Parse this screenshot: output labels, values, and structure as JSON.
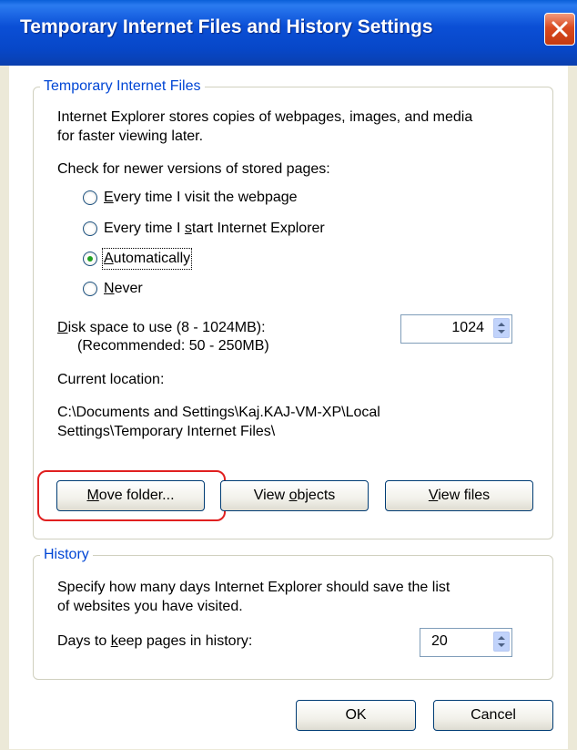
{
  "window": {
    "title": "Temporary Internet Files and History Settings"
  },
  "tif": {
    "legend": "Temporary Internet Files",
    "description_line1": "Internet Explorer stores copies of webpages, images, and media",
    "description_line2": "for faster viewing later.",
    "check_label": "Check for newer versions of stored pages:",
    "radios": [
      {
        "prefix": "",
        "ul": "E",
        "rest": "very time I visit the webpage",
        "checked": false
      },
      {
        "prefix": "Every time I ",
        "ul": "s",
        "rest": "tart Internet Explorer",
        "checked": false
      },
      {
        "prefix": "",
        "ul": "A",
        "rest": "utomatically",
        "checked": true
      },
      {
        "prefix": "",
        "ul": "N",
        "rest": "ever",
        "checked": false
      }
    ],
    "disk_label_ul": "D",
    "disk_label_rest": "isk space to use (8 - 1024MB):",
    "disk_recommended": "(Recommended: 50 - 250MB)",
    "disk_value": "1024",
    "current_location_label": "Current location:",
    "location_line1": "C:\\Documents and Settings\\Kaj.KAJ-VM-XP\\Local",
    "location_line2": "Settings\\Temporary Internet Files\\",
    "buttons": {
      "move_ul": "M",
      "move_rest": "ove folder...",
      "view_objects_pre": "View ",
      "view_objects_ul": "o",
      "view_objects_rest": "bjects",
      "view_files_ul": "V",
      "view_files_rest": "iew files"
    }
  },
  "history": {
    "legend": "History",
    "description_line1": "Specify how many days Internet Explorer should save the list",
    "description_line2": "of websites you have visited.",
    "days_label_pre": "Days to ",
    "days_label_ul": "k",
    "days_label_rest": "eep pages in history:",
    "days_value": "20"
  },
  "footer": {
    "ok_label": "OK",
    "cancel_label": "Cancel"
  },
  "colors": {
    "titlebar": "#0747c8",
    "legend": "#0046d5",
    "highlight": "#e02020",
    "radio_dot": "#21a121"
  },
  "icons": {
    "close": "close-icon",
    "spin_up": "spin-up-icon",
    "spin_down": "spin-down-icon"
  }
}
